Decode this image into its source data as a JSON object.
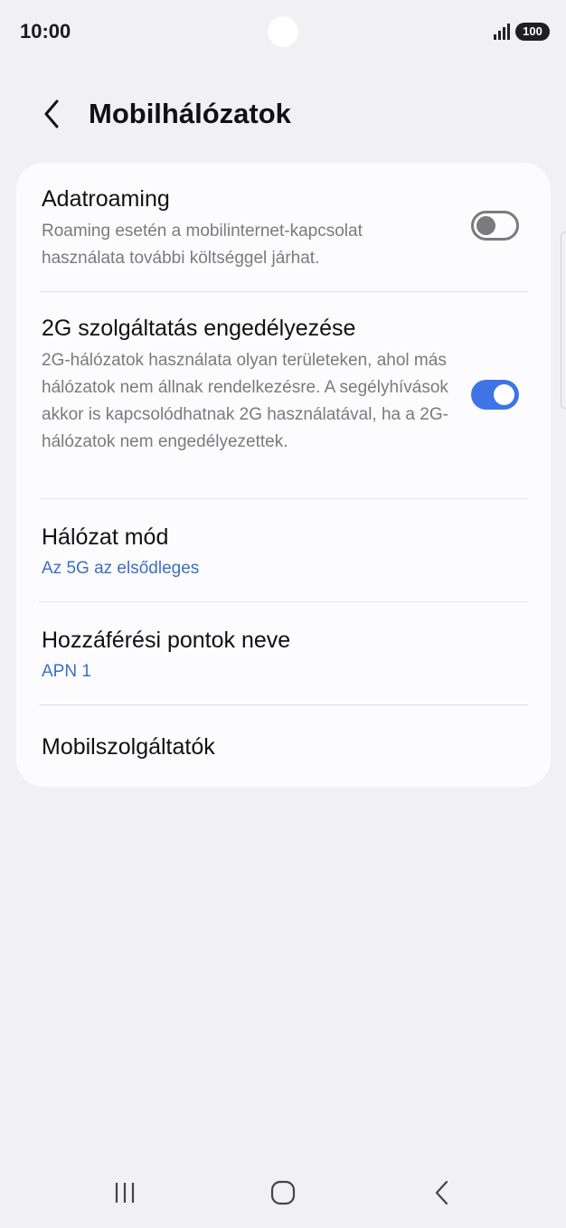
{
  "status_bar": {
    "time": "10:00",
    "battery_level": "100",
    "icons": [
      "camera-cutout",
      "signal-icon",
      "battery-icon"
    ]
  },
  "header": {
    "back_icon": "chevron-left-icon",
    "title": "Mobilhálózatok"
  },
  "settings": {
    "roaming": {
      "title": "Adatroaming",
      "description": "Roaming esetén a mobilinternet-kapcsolat használata további költséggel járhat.",
      "enabled": false
    },
    "allow_2g": {
      "title": "2G szolgáltatás engedélyezése",
      "description": "2G-hálózatok használata olyan területeken, ahol más hálózatok nem állnak rendelkezésre. A segélyhívások akkor is kapcsolódhatnak 2G használatával, ha a 2G-hálózatok nem engedélyezettek.",
      "enabled": true
    },
    "network_mode": {
      "title": "Hálózat mód",
      "value": "Az 5G az elsődleges"
    },
    "apn": {
      "title": "Hozzáférési pontok neve",
      "value": "APN 1"
    },
    "operators": {
      "title": "Mobilszolgáltatók"
    }
  },
  "colors": {
    "background": "#f1f1f4",
    "card": "#fcfcfe",
    "accent_blue": "#3e74e6",
    "value_blue": "#3d6fc1",
    "secondary_text": "#7b7b7e"
  },
  "nav_bar": {
    "icons": [
      "recent-apps-icon",
      "home-icon",
      "back-icon"
    ]
  }
}
